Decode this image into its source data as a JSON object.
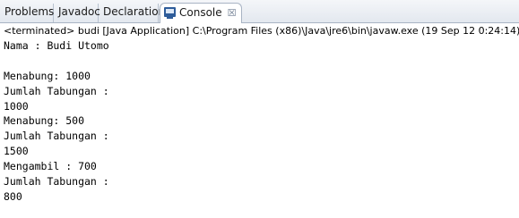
{
  "tabs": {
    "problems": "Problems",
    "javadoc": "Javadoc",
    "declaration": "Declaration",
    "console": "Console"
  },
  "icons": {
    "console": "console-icon",
    "close": "close-icon"
  },
  "close_glyph": "☒",
  "status_line": "<terminated> budi [Java Application] C:\\Program Files (x86)\\Java\\jre6\\bin\\javaw.exe (19 Sep 12 0:24:14)",
  "console_lines": [
    "Nama : Budi Utomo",
    "",
    "Menabung: 1000",
    "Jumlah Tabungan :",
    "1000",
    "Menabung: 500",
    "Jumlah Tabungan :",
    "1500",
    "Mengambil : 700",
    "Jumlah Tabungan :",
    "800"
  ]
}
